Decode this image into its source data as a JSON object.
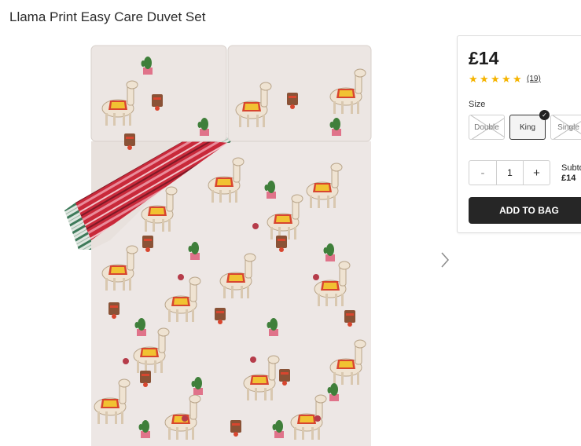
{
  "product": {
    "title": "Llama Print Easy Care Duvet Set",
    "price": "£14",
    "rating": 5,
    "reviews": "(19)"
  },
  "size": {
    "label": "Size",
    "options": [
      {
        "label": "Double",
        "available": false
      },
      {
        "label": "King",
        "available": true,
        "selected": true
      },
      {
        "label": "Single",
        "available": false
      }
    ]
  },
  "quantity": {
    "minus": "-",
    "value": "1",
    "plus": "+"
  },
  "subtotal": {
    "label": "Subtotal",
    "amount": "£14"
  },
  "cta": {
    "add_to_bag": "ADD TO BAG"
  },
  "icons": {
    "next": "chevron-right-icon",
    "star": "star-icon",
    "check": "check-icon"
  },
  "colors": {
    "star": "#f5b400",
    "button": "#262626"
  }
}
